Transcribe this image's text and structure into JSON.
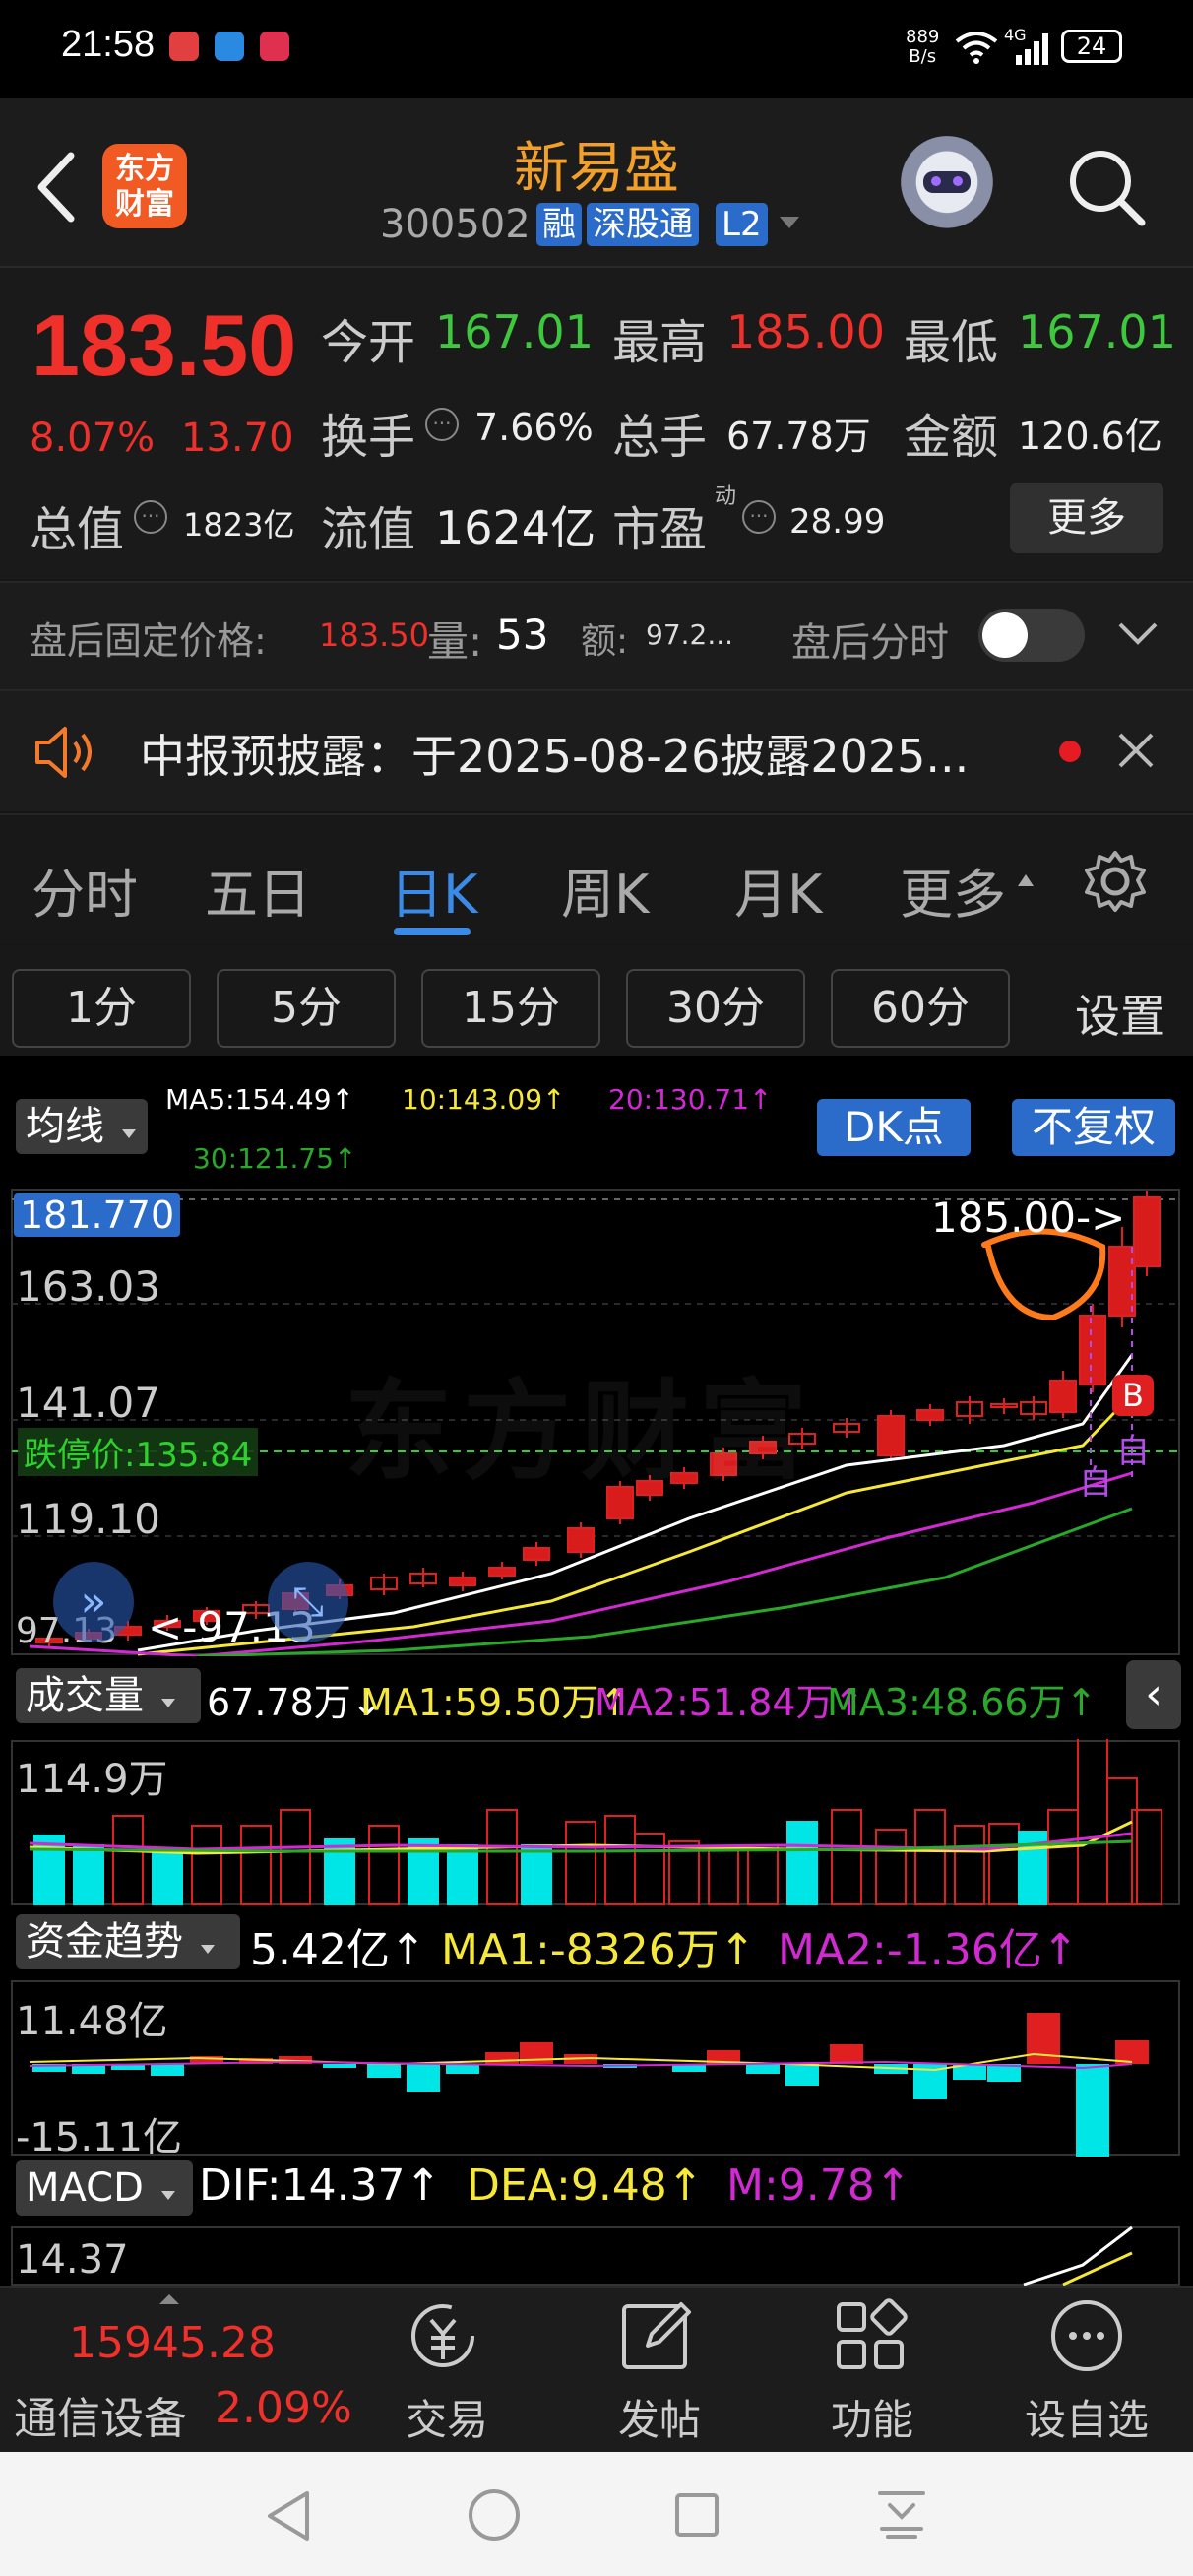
{
  "status_bar": {
    "time": "21:58",
    "net_speed_top": "889",
    "net_speed_bottom": "B/s",
    "signal": "4G",
    "battery": "24"
  },
  "header": {
    "title": "新易盛",
    "code": "300502",
    "tags": [
      "融",
      "深股通",
      "L2"
    ],
    "logo_text": [
      "东方",
      "财富"
    ]
  },
  "quote": {
    "price": "183.50",
    "change_pct": "8.07%",
    "change_amt": "13.70",
    "open_label": "今开",
    "open": "167.01",
    "high_label": "最高",
    "high": "185.00",
    "low_label": "最低",
    "low": "167.01",
    "turnover_label": "换手",
    "turnover": "7.66%",
    "volume_label": "总手",
    "volume": "67.78万",
    "amount_label": "金额",
    "amount": "120.6亿",
    "mktcap_label": "总值",
    "mktcap": "1823亿",
    "float_label": "流值",
    "float_cap": "1624亿",
    "pe_label": "市盈",
    "pe_sup": "动",
    "pe": "28.99",
    "more": "更多"
  },
  "after_hours": {
    "label": "盘后固定价格:",
    "price": "183.50",
    "qty_label": "量:",
    "qty": "53",
    "amt_label": "额:",
    "amt": "97.2...",
    "toggle_label": "盘后分时"
  },
  "notice": {
    "text": "中报预披露：于2025-08-26披露2025..."
  },
  "tabs": [
    "分时",
    "五日",
    "日K",
    "周K",
    "月K",
    "更多"
  ],
  "active_tab": 2,
  "periods": [
    "1分",
    "5分",
    "15分",
    "30分",
    "60分"
  ],
  "settings": "设置",
  "ma_bar": {
    "selector": "均线",
    "ma5": "MA5:154.49↑",
    "ma10": "10:143.09↑",
    "ma20": "20:130.71↑",
    "ma30": "30:121.75↑",
    "dk": "DK点",
    "fq": "不复权"
  },
  "kline": {
    "axis": [
      "181.770",
      "163.03",
      "141.07",
      "119.10",
      "97.13"
    ],
    "limit_down": "跌停价:135.84",
    "high_mark": "185.00->",
    "low_mark": "<-97.13",
    "watermark": "东方财富",
    "b_mark": "B",
    "zi_mark": "自",
    "colors": {
      "ma5": "#ffffff",
      "ma10": "#f5e83a",
      "ma20": "#d22ad2",
      "ma30": "#2aa82a",
      "up": "#e02020",
      "down": "#00e5e5"
    }
  },
  "volume_panel": {
    "selector": "成交量",
    "value": "67.78万↓",
    "ma1": "MA1:59.50万↑",
    "ma2": "MA2:51.84万↑",
    "ma3": "MA3:48.66万↑",
    "axis_top": "114.9万"
  },
  "fund_panel": {
    "selector": "资金趋势",
    "value": "5.42亿↑",
    "ma1": "MA1:-8326万↑",
    "ma2": "MA2:-1.36亿↑",
    "axis_top": "11.48亿",
    "axis_bottom": "-15.11亿"
  },
  "macd_panel": {
    "selector": "MACD",
    "dif": "DIF:14.37↑",
    "dea": "DEA:9.48↑",
    "m": "M:9.78↑",
    "axis_top": "14.37"
  },
  "bottom_nav": {
    "index_value": "15945.28",
    "index_name": "通信设备",
    "index_pct": "2.09%",
    "items": [
      "交易",
      "发帖",
      "功能",
      "设自选"
    ]
  }
}
